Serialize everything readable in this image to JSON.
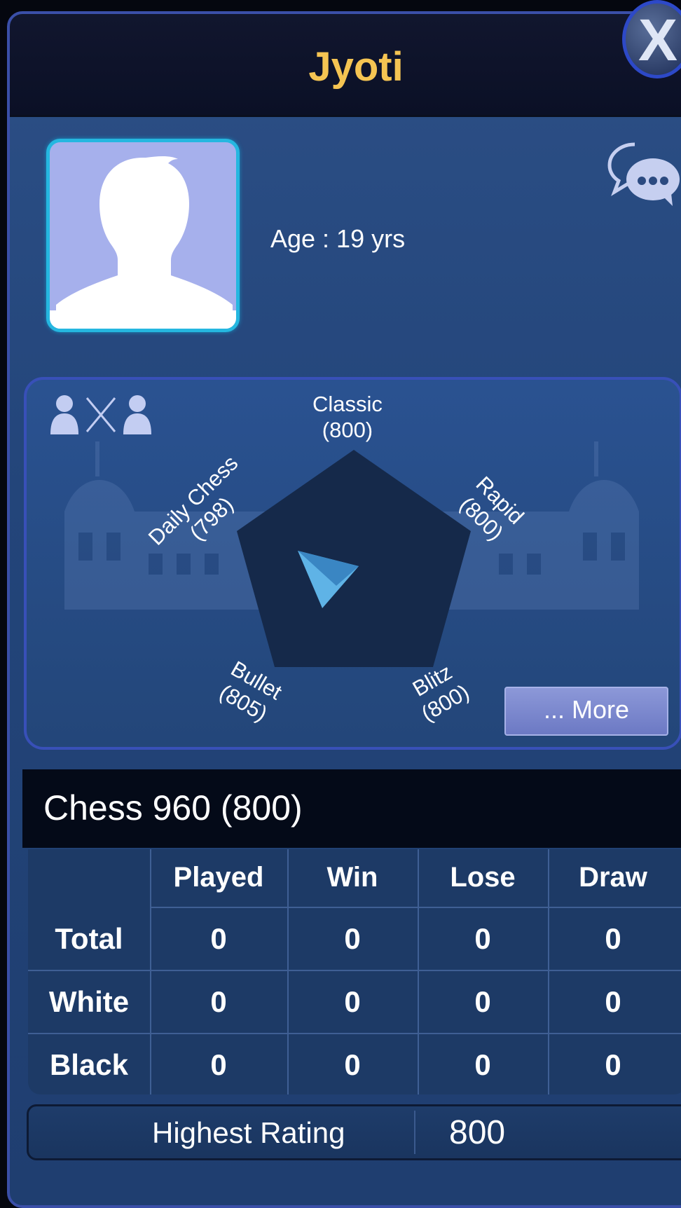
{
  "header": {
    "title": "Jyoti",
    "close_label": "X"
  },
  "profile": {
    "age_text": "Age :  19 yrs"
  },
  "ratings": [
    {
      "name": "Classic",
      "value": "(800)"
    },
    {
      "name": "Rapid",
      "value": "(800)"
    },
    {
      "name": "Blitz",
      "value": "(800)"
    },
    {
      "name": "Bullet",
      "value": "(805)"
    },
    {
      "name": "Daily Chess",
      "value": "(798)"
    }
  ],
  "more_label": "... More",
  "game": {
    "title": "Chess 960 (800)"
  },
  "stats": {
    "columns": [
      "Played",
      "Win",
      "Lose",
      "Draw"
    ],
    "rows": [
      {
        "label": "Total",
        "values": [
          "0",
          "0",
          "0",
          "0"
        ]
      },
      {
        "label": "White",
        "values": [
          "0",
          "0",
          "0",
          "0"
        ]
      },
      {
        "label": "Black",
        "values": [
          "0",
          "0",
          "0",
          "0"
        ]
      }
    ]
  },
  "highest_rating": {
    "label": "Highest Rating",
    "value": "800"
  },
  "colors": {
    "title": "#f5c452",
    "avatar_border": "#25b7e0",
    "panel_border": "#3a4fa8"
  },
  "icons": [
    "close-icon",
    "chat-icon",
    "versus-icon",
    "castle-background",
    "play-triangle-icon"
  ]
}
